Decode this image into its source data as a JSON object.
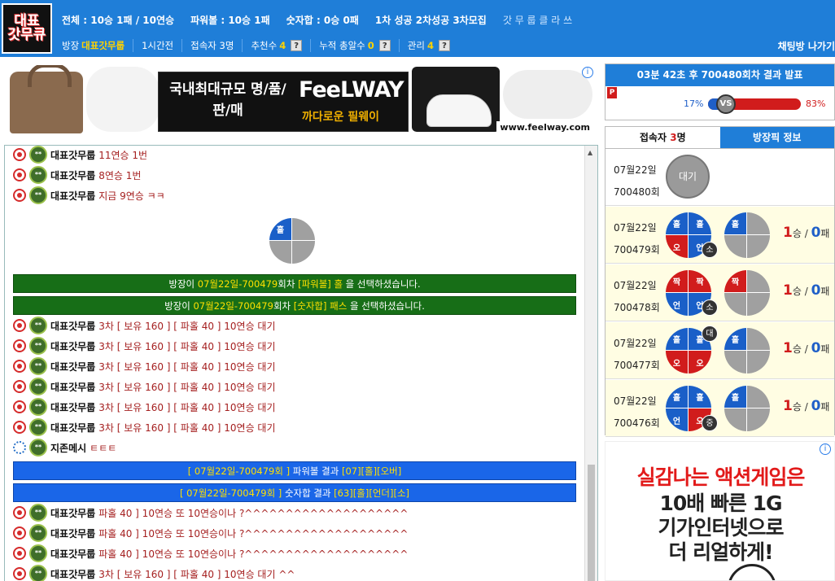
{
  "header": {
    "logo_line1": "대표",
    "logo_line2": "갓무큐",
    "stats": {
      "total": "전체 : 10승 1패 / 10연승",
      "powerball": "파워볼 : 10승 1패",
      "numsum": "숫자합 : 0승 0패",
      "slogan_bold": "1차 성공 2차성공 3차모집",
      "slogan": "갓 무 룹 클 라 쓰"
    },
    "subbar": {
      "owner_label": "방장",
      "owner_value": "대표갓무룹",
      "age": "1시간전",
      "users_label": "접속자 3명",
      "recommend_label": "추천수",
      "recommend_value": "4",
      "revenue_label": "누적 총알수",
      "revenue_value": "0",
      "manager_label": "관리",
      "manager_value": "4",
      "q": "?",
      "chat_exit": "채팅방 나가기"
    }
  },
  "ad_top": {
    "left_text": "국내최대규모 명/품/판/매",
    "brand": "FeeLWAY",
    "sub": "까다로운 필웨이",
    "url": "www.feelway.com",
    "info": "i"
  },
  "chat": {
    "messages": [
      {
        "nick": "대표갓무룹",
        "text": "11연승 1번",
        "icon": "red"
      },
      {
        "nick": "대표갓무룹",
        "text": "8연승 1번",
        "icon": "red"
      },
      {
        "nick": "대표갓무룹",
        "text": "지금 9연승 ㅋㅋ",
        "icon": "red"
      },
      {
        "nick": "대표갓무룹",
        "text": "3차 [ 보유 160 ] [ 파홀 40 ] 10연승 대기",
        "icon": "red"
      },
      {
        "nick": "대표갓무룹",
        "text": "3차 [ 보유 160 ] [ 파홀 40 ] 10연승 대기",
        "icon": "red"
      },
      {
        "nick": "대표갓무룹",
        "text": "3차 [ 보유 160 ] [ 파홀 40 ] 10연승 대기",
        "icon": "red"
      },
      {
        "nick": "대표갓무룹",
        "text": "3차 [ 보유 160 ] [ 파홀 40 ] 10연승 대기",
        "icon": "red"
      },
      {
        "nick": "대표갓무룹",
        "text": "3차 [ 보유 160 ] [ 파홀 40 ] 10연승 대기",
        "icon": "red"
      },
      {
        "nick": "대표갓무룹",
        "text": "3차 [ 보유 160 ] [ 파홀 40 ] 10연승 대기",
        "icon": "red"
      },
      {
        "nick": "지존메시",
        "text": "ㅌㅌㅌ",
        "icon": "blue"
      },
      {
        "nick": "대표갓무룹",
        "text": "파홀 40 ] 10연승  또 10연승이나 ?^^^^^^^^^^^^^^^^^^^^",
        "icon": "red"
      },
      {
        "nick": "대표갓무룹",
        "text": "파홀 40 ] 10연승  또 10연승이나 ?^^^^^^^^^^^^^^^^^^^^",
        "icon": "red"
      },
      {
        "nick": "대표갓무룹",
        "text": "파홀 40 ] 10연승  또 10연승이나 ?^^^^^^^^^^^^^^^^^^^^",
        "icon": "red"
      },
      {
        "nick": "대표갓무룹",
        "text": "3차 [ 보유 160 ] [ 파홀 40 ] 10연승 대기 ^^",
        "icon": "red"
      }
    ],
    "pick_pie": {
      "tl": "홀"
    },
    "sys1": {
      "pre": "방장이 ",
      "round": "07월22일-700479",
      "mid": "회차 ",
      "kind": "[파워볼] 홀",
      "post": " 을 선택하셨습니다."
    },
    "sys2": {
      "pre": "방장이 ",
      "round": "07월22일-700479",
      "mid": "회차 ",
      "kind": "[숫자합] 패스",
      "post": " 을 선택하셨습니다."
    },
    "res1": {
      "pre": "[ 07월22일-700479회 ]",
      "mid": " 파워볼 결과 ",
      "val": "[07][홀][오버]"
    },
    "res2": {
      "pre": "[ 07월22일-700479회 ]",
      "mid": " 숫자합 결과 ",
      "val": "[63][홀][언더][소]"
    }
  },
  "countdown": {
    "text": "03분 42초 후 700480회차 결과 발표",
    "flag": "P",
    "left_pct": "17%",
    "right_pct": "83%",
    "left_fraction": 0.17,
    "vs": "VS"
  },
  "tabs": {
    "users_prefix": "접속자 ",
    "users_count": "3",
    "users_suffix": "명",
    "owner_info": "방장픽 정보"
  },
  "rounds": [
    {
      "date": "07월22일",
      "no": "700480회",
      "status": "대기",
      "win": "",
      "lose": "",
      "pie_main": null
    },
    {
      "date": "07월22일",
      "no": "700479회",
      "win": "1",
      "lose": "0",
      "pie_main": [
        "홀",
        "홀",
        "오",
        "언"
      ],
      "badge": "소",
      "pie_pick": [
        "홀",
        "",
        "",
        ""
      ]
    },
    {
      "date": "07월22일",
      "no": "700478회",
      "win": "1",
      "lose": "0",
      "pie_main": [
        "짝",
        "짝",
        "언",
        "언"
      ],
      "badge": "소",
      "pie_pick": [
        "짝",
        "",
        "",
        ""
      ]
    },
    {
      "date": "07월22일",
      "no": "700477회",
      "win": "1",
      "lose": "0",
      "pie_main": [
        "홀",
        "홀",
        "오",
        "오"
      ],
      "badge": "대",
      "pie_pick": [
        "홀",
        "",
        "",
        ""
      ]
    },
    {
      "date": "07월22일",
      "no": "700476회",
      "win": "1",
      "lose": "0",
      "pie_main": [
        "홀",
        "홀",
        "언",
        "오"
      ],
      "badge": "중",
      "pie_pick": [
        "홀",
        "",
        "",
        ""
      ]
    }
  ],
  "score_labels": {
    "win_unit": "승",
    "sep": " / ",
    "lose_unit": "패"
  },
  "ad_side": {
    "line1": "실감나는 액션게임은",
    "line2": "10배 빠른 1G",
    "line3": "기가인터넷으로",
    "line4": "더 리얼하게!",
    "info": "i"
  },
  "colors": {
    "header_blue": "#1f7ed8",
    "system_green": "#176e17",
    "result_blue": "#1a66e8",
    "hol": "#1a5fc8",
    "jjak": "#d11c1c"
  }
}
